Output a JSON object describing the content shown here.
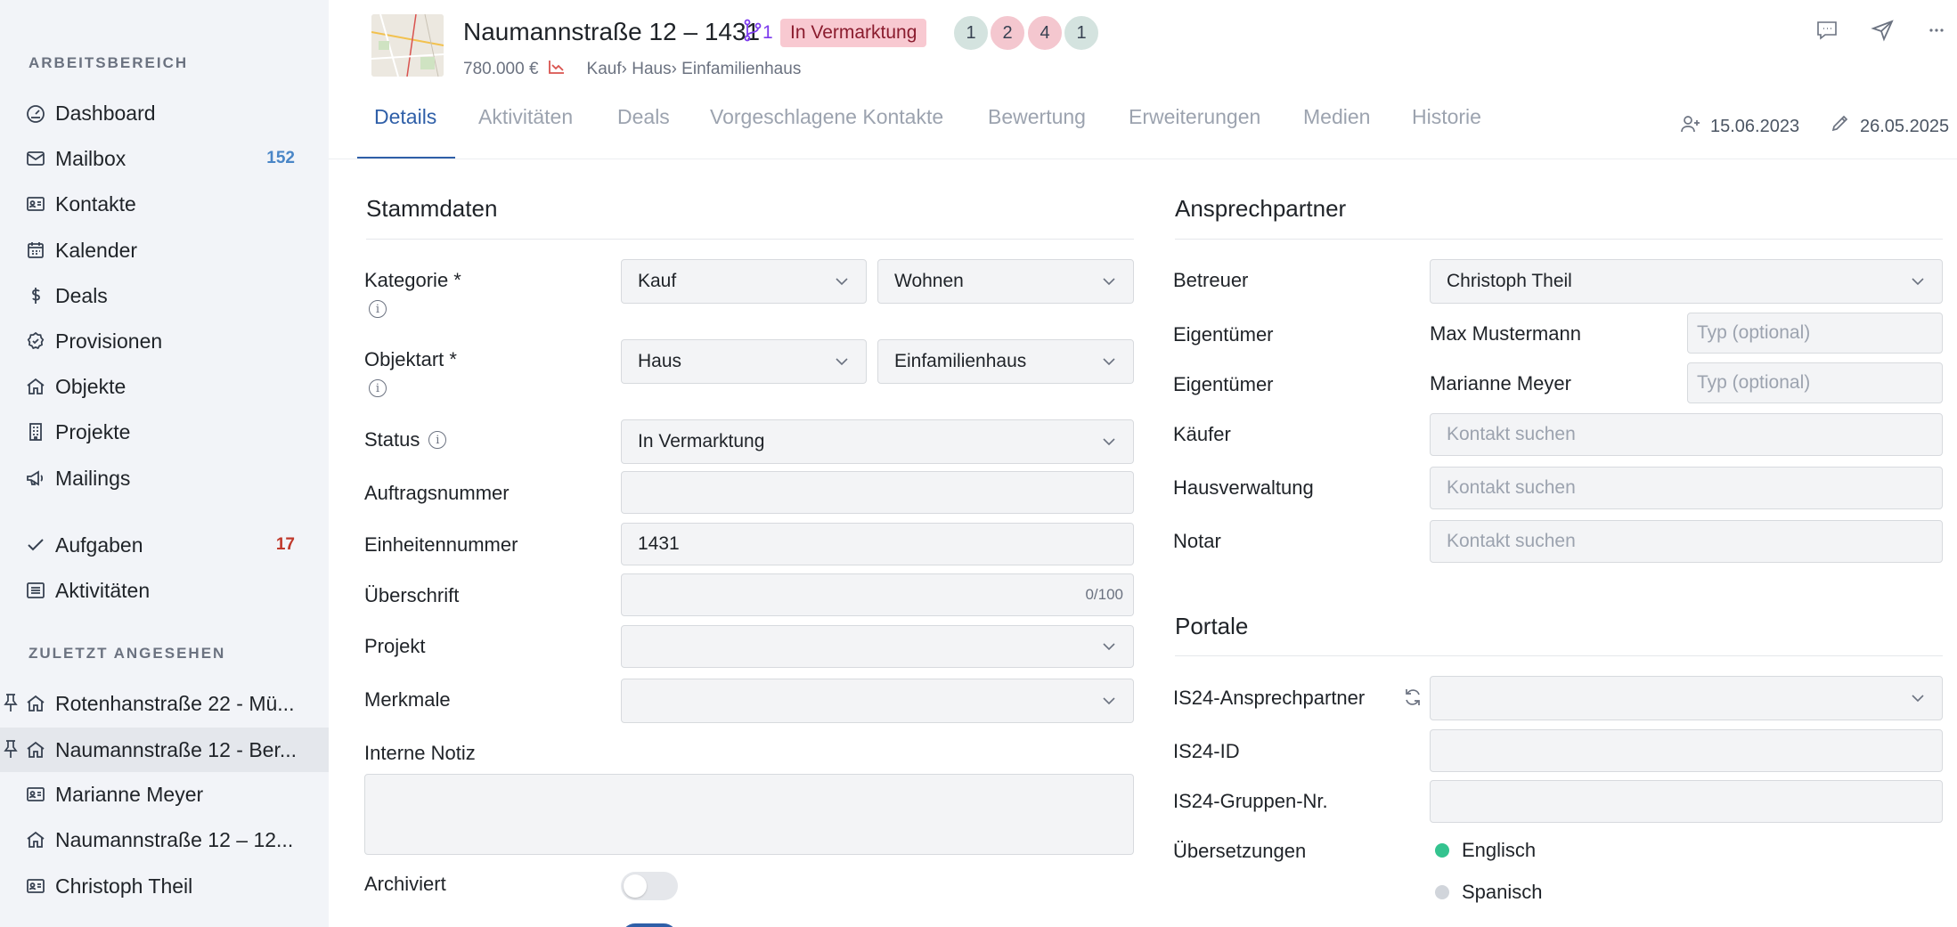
{
  "sidebar": {
    "workspace_label": "ARBEITSBEREICH",
    "recent_label": "ZULETZT ANGESEHEN",
    "items": [
      {
        "label": "Dashboard",
        "icon": "dashboard-icon"
      },
      {
        "label": "Mailbox",
        "icon": "mail-icon",
        "count": "152",
        "count_color": "#4a86c7"
      },
      {
        "label": "Kontakte",
        "icon": "contact-card-icon"
      },
      {
        "label": "Kalender",
        "icon": "calendar-icon"
      },
      {
        "label": "Deals",
        "icon": "dollar-icon"
      },
      {
        "label": "Provisionen",
        "icon": "badge-icon"
      },
      {
        "label": "Objekte",
        "icon": "house-icon"
      },
      {
        "label": "Projekte",
        "icon": "building-icon"
      },
      {
        "label": "Mailings",
        "icon": "megaphone-icon"
      },
      {
        "label": "Aufgaben",
        "icon": "check-icon",
        "count": "17",
        "count_color": "#c0392b"
      },
      {
        "label": "Aktivitäten",
        "icon": "list-icon"
      }
    ],
    "recent": [
      {
        "label": "Rotenhanstraße 22 - Mü...",
        "icon": "house-icon",
        "pinned": true
      },
      {
        "label": "Naumannstraße 12 - Ber...",
        "icon": "house-icon",
        "pinned": true,
        "active": true
      },
      {
        "label": "Marianne Meyer",
        "icon": "contact-card-icon"
      },
      {
        "label": "Naumannstraße 12 – 12...",
        "icon": "house-icon"
      },
      {
        "label": "Christoph Theil",
        "icon": "contact-card-icon"
      }
    ]
  },
  "header": {
    "title": "Naumannstraße 12 – 1431",
    "branch_count": "1",
    "status": "In Vermarktung",
    "counters": [
      {
        "value": "1",
        "color": "#d4e3df"
      },
      {
        "value": "2",
        "color": "#f4c7cf"
      },
      {
        "value": "4",
        "color": "#f4c7cf"
      },
      {
        "value": "1",
        "color": "#d4e3df"
      }
    ],
    "price": "780.000 €",
    "breadcrumb": "Kauf› Haus› Einfamilienhaus"
  },
  "tabs": [
    "Details",
    "Aktivitäten",
    "Deals",
    "Vorgeschlagene Kontakte",
    "Bewertung",
    "Erweiterungen",
    "Medien",
    "Historie"
  ],
  "meta": {
    "created": "15.06.2023",
    "edited": "26.05.2025"
  },
  "stammdaten": {
    "title": "Stammdaten",
    "kategorie_label": "Kategorie *",
    "kategorie_1": "Kauf",
    "kategorie_2": "Wohnen",
    "objektart_label": "Objektart *",
    "objektart_1": "Haus",
    "objektart_2": "Einfamilienhaus",
    "status_label": "Status",
    "status_value": "In Vermarktung",
    "auftragsnummer_label": "Auftragsnummer",
    "auftragsnummer_value": "",
    "einheitennummer_label": "Einheitennummer",
    "einheitennummer_value": "1431",
    "ueberschrift_label": "Überschrift",
    "ueberschrift_counter": "0/100",
    "projekt_label": "Projekt",
    "merkmale_label": "Merkmale",
    "notiz_label": "Interne Notiz",
    "archiviert_label": "Archiviert"
  },
  "ansprechpartner": {
    "title": "Ansprechpartner",
    "betreuer_label": "Betreuer",
    "betreuer_value": "Christoph Theil",
    "eigentuemer_label": "Eigentümer",
    "eigentuemer_1": "Max Mustermann",
    "eigentuemer_2": "Marianne Meyer",
    "typ_placeholder": "Typ (optional)",
    "kaeufer_label": "Käufer",
    "hausverwaltung_label": "Hausverwaltung",
    "notar_label": "Notar",
    "kontakt_placeholder": "Kontakt suchen"
  },
  "portale": {
    "title": "Portale",
    "is24_ansprechpartner_label": "IS24-Ansprechpartner",
    "is24_id_label": "IS24-ID",
    "is24_gruppen_label": "IS24-Gruppen-Nr.",
    "uebersetzungen_label": "Übersetzungen",
    "languages": [
      {
        "name": "Englisch",
        "color": "#34c38f"
      },
      {
        "name": "Spanisch",
        "color": "#d1d5db"
      }
    ]
  }
}
